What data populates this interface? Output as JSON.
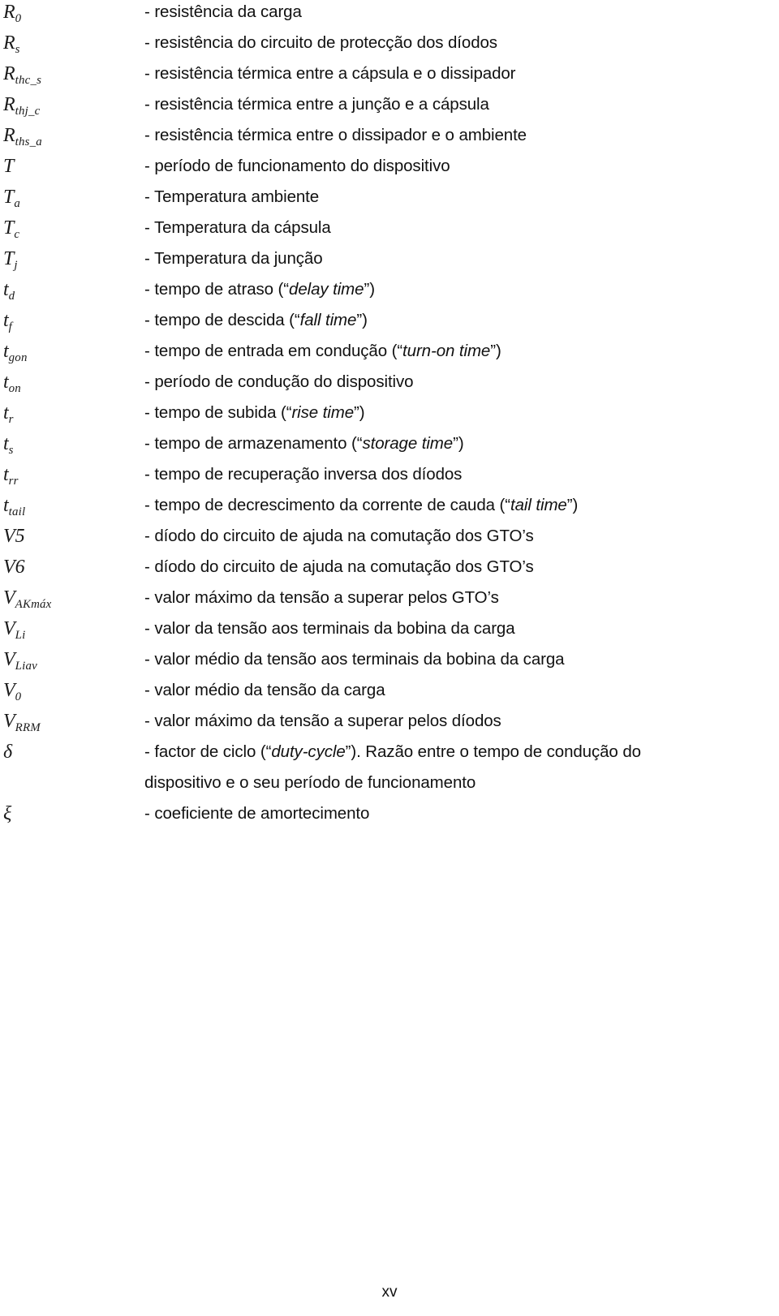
{
  "document": {
    "page_number": "xv",
    "language": "pt"
  },
  "entries": [
    {
      "symbol_base": "R",
      "symbol_sub": "0",
      "description": "- resistência da carga"
    },
    {
      "symbol_base": "R",
      "symbol_sub": "s",
      "description": "- resistência do circuito de protecção dos díodos"
    },
    {
      "symbol_base": "R",
      "symbol_sub": "thc_s",
      "description": "- resistência térmica entre a cápsula e o dissipador"
    },
    {
      "symbol_base": "R",
      "symbol_sub": "thj_c",
      "description": "- resistência térmica entre a junção e a cápsula"
    },
    {
      "symbol_base": "R",
      "symbol_sub": "ths_a",
      "description": "- resistência térmica entre o dissipador e o ambiente"
    },
    {
      "symbol_base": "T",
      "symbol_sub": "",
      "description": "- período de funcionamento do dispositivo"
    },
    {
      "symbol_base": "T",
      "symbol_sub": "a",
      "description": "- Temperatura ambiente"
    },
    {
      "symbol_base": "T",
      "symbol_sub": "c",
      "description": "- Temperatura da cápsula"
    },
    {
      "symbol_base": "T",
      "symbol_sub": "j",
      "description": "- Temperatura da junção"
    },
    {
      "symbol_base": "t",
      "symbol_sub": "d",
      "desc_pre": "- tempo de atraso (“",
      "desc_italic": "delay time",
      "desc_post": "”)"
    },
    {
      "symbol_base": "t",
      "symbol_sub": "f",
      "desc_pre": "- tempo de descida (“",
      "desc_italic": "fall time",
      "desc_post": "”)"
    },
    {
      "symbol_base": "t",
      "symbol_sub": "gon",
      "desc_pre": "- tempo de entrada em condução (“",
      "desc_italic": "turn-on time",
      "desc_post": "”)"
    },
    {
      "symbol_base": "t",
      "symbol_sub": "on",
      "description": "- período de condução do dispositivo"
    },
    {
      "symbol_base": "t",
      "symbol_sub": "r",
      "desc_pre": "- tempo de subida (“",
      "desc_italic": "rise time",
      "desc_post": "”)"
    },
    {
      "symbol_base": "t",
      "symbol_sub": "s",
      "desc_pre": "- tempo de armazenamento (“",
      "desc_italic": "storage time",
      "desc_post": "”)"
    },
    {
      "symbol_base": "t",
      "symbol_sub": "rr",
      "description": "- tempo de recuperação inversa dos díodos"
    },
    {
      "symbol_base": "t",
      "symbol_sub": "tail",
      "desc_pre": "- tempo de decrescimento da corrente de cauda (“",
      "desc_italic": "tail time",
      "desc_post": "”)"
    },
    {
      "symbol_base": "V5",
      "symbol_sub": "",
      "description": "- díodo do circuito de ajuda na comutação dos GTO’s"
    },
    {
      "symbol_base": "V6",
      "symbol_sub": "",
      "description": "- díodo do circuito de ajuda na comutação dos GTO’s"
    },
    {
      "symbol_base": "V",
      "symbol_sub": "AKmáx",
      "description": "- valor máximo da tensão a superar pelos GTO’s"
    },
    {
      "symbol_base": "V",
      "symbol_sub": "Li",
      "description": "- valor da tensão aos terminais da bobina da carga"
    },
    {
      "symbol_base": "V",
      "symbol_sub": "Liav",
      "description": "- valor médio da tensão aos terminais da bobina da carga"
    },
    {
      "symbol_base": "V",
      "symbol_sub": "0",
      "description": "- valor médio da tensão da carga"
    },
    {
      "symbol_base": "V",
      "symbol_sub": "RRM",
      "description": "- valor máximo da tensão a superar pelos díodos"
    },
    {
      "symbol_base": "δ",
      "symbol_sub": "",
      "desc_pre": "- factor de ciclo (“",
      "desc_italic": "duty-cycle",
      "desc_post": "”). Razão entre o tempo de condução do",
      "desc_continuation": "dispositivo e o seu período de funcionamento"
    },
    {
      "symbol_base": "ξ",
      "symbol_sub": "",
      "description": "- coeficiente de amortecimento"
    }
  ]
}
